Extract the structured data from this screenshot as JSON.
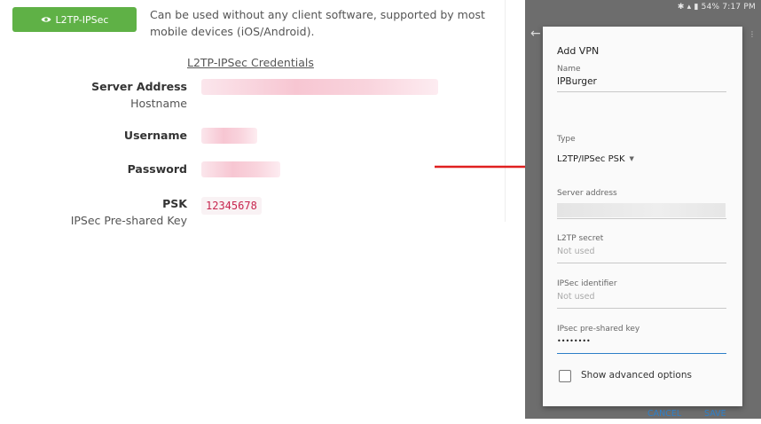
{
  "protocol": {
    "button_label": "L2TP-IPSec",
    "button_icon": "eye-icon",
    "description": "Can be used without any client software, supported by most mobile devices (iOS/Android)."
  },
  "credentials": {
    "title": "L2TP-IPSec Credentials",
    "server_address_label": "Server Address",
    "server_address_sub": "Hostname",
    "username_label": "Username",
    "password_label": "Password",
    "psk_label": "PSK",
    "psk_sub": "IPSec Pre-shared Key",
    "psk_value": "12345678"
  },
  "phone": {
    "status": "54% 7:17 PM",
    "dialog": {
      "title": "Add VPN",
      "name_label": "Name",
      "name_value": "IPBurger",
      "type_label": "Type",
      "type_value": "L2TP/IPSec PSK",
      "server_label": "Server address",
      "l2tp_secret_label": "L2TP secret",
      "l2tp_secret_hint": "Not used",
      "ipsec_id_label": "IPSec identifier",
      "ipsec_id_hint": "Not used",
      "psk_label": "IPsec pre-shared key",
      "psk_value": "••••••••",
      "advanced_label": "Show advanced options",
      "cancel_label": "CANCEL",
      "save_label": "SAVE"
    }
  },
  "colors": {
    "button_green": "#5fb146",
    "psk_code_text": "#c7254e",
    "arrow_red": "#e02020",
    "dialog_accent": "#2d7fc8"
  }
}
